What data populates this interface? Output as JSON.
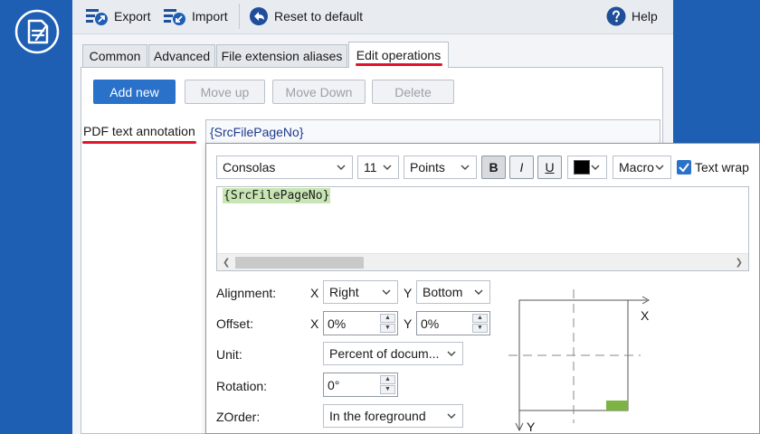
{
  "toolbar": {
    "export_label": "Export",
    "import_label": "Import",
    "reset_label": "Reset to default",
    "help_label": "Help"
  },
  "tabs": [
    {
      "label": "Common"
    },
    {
      "label": "Advanced"
    },
    {
      "label": "File extension aliases"
    },
    {
      "label": "Edit operations",
      "active": true
    }
  ],
  "actions": {
    "add_new": "Add new",
    "move_up": "Move up",
    "move_down": "Move Down",
    "delete": "Delete"
  },
  "annotation": {
    "label": "PDF text annotation",
    "value": "{SrcFilePageNo}"
  },
  "format": {
    "font": "Consolas",
    "size": "11",
    "unit": "Points",
    "bold_label": "B",
    "italic_label": "I",
    "underline_label": "U",
    "color": "#000000",
    "macro_label": "Macro",
    "text_wrap_label": "Text wrap",
    "text_wrap_checked": true
  },
  "editor": {
    "text": "{SrcFilePageNo}"
  },
  "placement": {
    "alignment_label": "Alignment:",
    "x_axis": "X",
    "y_axis": "Y",
    "align_x": "Right",
    "align_y": "Bottom",
    "offset_label": "Offset:",
    "offset_x": "0%",
    "offset_y": "0%",
    "unit_label": "Unit:",
    "unit_value": "Percent of docum...",
    "rotation_label": "Rotation:",
    "rotation_value": "0°",
    "zorder_label": "ZOrder:",
    "zorder_value": "In the foreground"
  },
  "diagram": {
    "x_label": "X",
    "y_label": "Y"
  },
  "colors": {
    "app_blue": "#1f5fb3",
    "primary_button": "#2a71c9",
    "underline_red": "#e0142b",
    "macro_highlight": "#c8e6b4",
    "page_marker": "#7cb342"
  }
}
